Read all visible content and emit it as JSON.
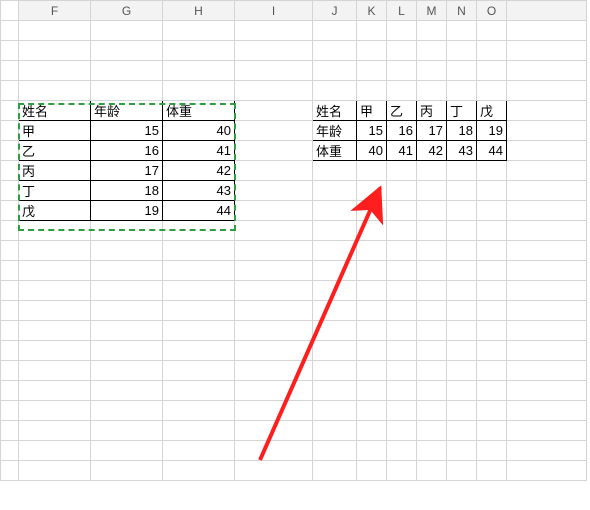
{
  "sheet": {
    "columns": [
      "F",
      "G",
      "H",
      "I",
      "J",
      "K",
      "L",
      "M",
      "N",
      "O"
    ]
  },
  "source_table": {
    "header": {
      "c0": "姓名",
      "c1": "年龄",
      "c2": "体重"
    },
    "rows": [
      {
        "name": "甲",
        "age": "15",
        "weight": "40"
      },
      {
        "name": "乙",
        "age": "16",
        "weight": "41"
      },
      {
        "name": "丙",
        "age": "17",
        "weight": "42"
      },
      {
        "name": "丁",
        "age": "18",
        "weight": "43"
      },
      {
        "name": "戊",
        "age": "19",
        "weight": "44"
      }
    ]
  },
  "result_table": {
    "rows": [
      {
        "label": "姓名",
        "v0": "甲",
        "v1": "乙",
        "v2": "丙",
        "v3": "丁",
        "v4": "戊"
      },
      {
        "label": "年龄",
        "v0": "15",
        "v1": "16",
        "v2": "17",
        "v3": "18",
        "v4": "19"
      },
      {
        "label": "体重",
        "v0": "40",
        "v1": "41",
        "v2": "42",
        "v3": "43",
        "v4": "44"
      }
    ]
  },
  "chart_data": [
    {
      "type": "table",
      "title": "source vertical table",
      "columns": [
        "姓名",
        "年龄",
        "体重"
      ],
      "rows": [
        [
          "甲",
          15,
          40
        ],
        [
          "乙",
          16,
          41
        ],
        [
          "丙",
          17,
          42
        ],
        [
          "丁",
          18,
          43
        ],
        [
          "戊",
          19,
          44
        ]
      ]
    },
    {
      "type": "table",
      "title": "transposed result table",
      "columns": [
        "",
        "甲",
        "乙",
        "丙",
        "丁",
        "戊"
      ],
      "rows": [
        [
          "年龄",
          15,
          16,
          17,
          18,
          19
        ],
        [
          "体重",
          40,
          41,
          42,
          43,
          44
        ]
      ]
    }
  ]
}
